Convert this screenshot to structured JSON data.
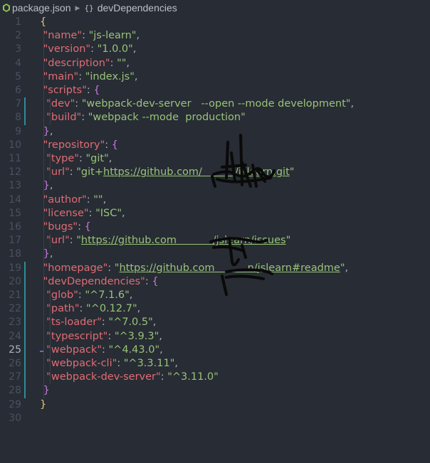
{
  "breadcrumb": {
    "file": "package.json",
    "section": "devDependencies"
  },
  "editor": {
    "active_line": 25,
    "line_numbers": [
      "1",
      "2",
      "3",
      "4",
      "5",
      "6",
      "7",
      "8",
      "9",
      "10",
      "11",
      "12",
      "13",
      "14",
      "15",
      "16",
      "17",
      "18",
      "19",
      "20",
      "21",
      "22",
      "23",
      "24",
      "25",
      "26",
      "27",
      "28",
      "29",
      "30"
    ],
    "lines": [
      [
        {
          "t": "{",
          "c": "b1"
        }
      ],
      [
        {
          "t": " "
        },
        {
          "t": "\"name\"",
          "c": "k"
        },
        {
          "t": ": "
        },
        {
          "t": "\"js-learn\"",
          "c": "s"
        },
        {
          "t": ","
        }
      ],
      [
        {
          "t": " "
        },
        {
          "t": "\"version\"",
          "c": "k"
        },
        {
          "t": ": "
        },
        {
          "t": "\"1.0.0\"",
          "c": "s"
        },
        {
          "t": ","
        }
      ],
      [
        {
          "t": " "
        },
        {
          "t": "\"description\"",
          "c": "k"
        },
        {
          "t": ": "
        },
        {
          "t": "\"\"",
          "c": "s"
        },
        {
          "t": ","
        }
      ],
      [
        {
          "t": " "
        },
        {
          "t": "\"main\"",
          "c": "k"
        },
        {
          "t": ": "
        },
        {
          "t": "\"index.js\"",
          "c": "s"
        },
        {
          "t": ","
        }
      ],
      [
        {
          "t": " "
        },
        {
          "t": "\"scripts\"",
          "c": "k"
        },
        {
          "t": ": "
        },
        {
          "t": "{",
          "c": "b2"
        }
      ],
      [
        {
          "t": "  "
        },
        {
          "t": "\"dev\"",
          "c": "k"
        },
        {
          "t": ": "
        },
        {
          "t": "\"webpack-dev-server   --open --mode development\"",
          "c": "s"
        },
        {
          "t": ","
        }
      ],
      [
        {
          "t": "  "
        },
        {
          "t": "\"build\"",
          "c": "k"
        },
        {
          "t": ": "
        },
        {
          "t": "\"webpack --mode  production\"",
          "c": "s"
        }
      ],
      [
        {
          "t": " "
        },
        {
          "t": "}",
          "c": "b2"
        },
        {
          "t": ","
        }
      ],
      [
        {
          "t": " "
        },
        {
          "t": "\"repository\"",
          "c": "k"
        },
        {
          "t": ": "
        },
        {
          "t": "{",
          "c": "b2"
        }
      ],
      [
        {
          "t": "  "
        },
        {
          "t": "\"type\"",
          "c": "k"
        },
        {
          "t": ": "
        },
        {
          "t": "\"git\"",
          "c": "s"
        },
        {
          "t": ","
        }
      ],
      [
        {
          "t": "  "
        },
        {
          "t": "\"url\"",
          "c": "k"
        },
        {
          "t": ": "
        },
        {
          "t": "\"git+",
          "c": "s"
        },
        {
          "t": "https://github.com/",
          "c": "s u"
        },
        {
          "t": "          ",
          "c": "s u"
        },
        {
          "t": "/jslearn.git",
          "c": "s u"
        },
        {
          "t": "\"",
          "c": "s"
        }
      ],
      [
        {
          "t": " "
        },
        {
          "t": "}",
          "c": "b2"
        },
        {
          "t": ","
        }
      ],
      [
        {
          "t": " "
        },
        {
          "t": "\"author\"",
          "c": "k"
        },
        {
          "t": ": "
        },
        {
          "t": "\"\"",
          "c": "s"
        },
        {
          "t": ","
        }
      ],
      [
        {
          "t": " "
        },
        {
          "t": "\"license\"",
          "c": "k"
        },
        {
          "t": ": "
        },
        {
          "t": "\"ISC\"",
          "c": "s"
        },
        {
          "t": ","
        }
      ],
      [
        {
          "t": " "
        },
        {
          "t": "\"bugs\"",
          "c": "k"
        },
        {
          "t": ": "
        },
        {
          "t": "{",
          "c": "b2"
        }
      ],
      [
        {
          "t": "  "
        },
        {
          "t": "\"url\"",
          "c": "k"
        },
        {
          "t": ": "
        },
        {
          "t": "\"",
          "c": "s"
        },
        {
          "t": "https://github.com",
          "c": "s u"
        },
        {
          "t": "           ",
          "c": "s u"
        },
        {
          "t": "/jslearn/issues",
          "c": "s u"
        },
        {
          "t": "\"",
          "c": "s"
        }
      ],
      [
        {
          "t": " "
        },
        {
          "t": "}",
          "c": "b2"
        },
        {
          "t": ","
        }
      ],
      [
        {
          "t": " "
        },
        {
          "t": "\"homepage\"",
          "c": "k"
        },
        {
          "t": ": "
        },
        {
          "t": "\"",
          "c": "s"
        },
        {
          "t": "https://github.com",
          "c": "s u"
        },
        {
          "t": "          ",
          "c": "s u"
        },
        {
          "t": "n/jslearn#readme",
          "c": "s u"
        },
        {
          "t": "\"",
          "c": "s"
        },
        {
          "t": ","
        }
      ],
      [
        {
          "t": " "
        },
        {
          "t": "\"devDependencies\"",
          "c": "k"
        },
        {
          "t": ": "
        },
        {
          "t": "{",
          "c": "b2"
        }
      ],
      [
        {
          "t": "  "
        },
        {
          "t": "\"glob\"",
          "c": "k"
        },
        {
          "t": ": "
        },
        {
          "t": "\"^7.1.6\"",
          "c": "s"
        },
        {
          "t": ","
        }
      ],
      [
        {
          "t": "  "
        },
        {
          "t": "\"path\"",
          "c": "k"
        },
        {
          "t": ": "
        },
        {
          "t": "\"^0.12.7\"",
          "c": "s"
        },
        {
          "t": ","
        }
      ],
      [
        {
          "t": "  "
        },
        {
          "t": "\"ts-loader\"",
          "c": "k"
        },
        {
          "t": ": "
        },
        {
          "t": "\"^7.0.5\"",
          "c": "s"
        },
        {
          "t": ","
        }
      ],
      [
        {
          "t": "  "
        },
        {
          "t": "\"typescript\"",
          "c": "k"
        },
        {
          "t": ": "
        },
        {
          "t": "\"^3.9.3\"",
          "c": "s"
        },
        {
          "t": ","
        }
      ],
      [
        {
          "t": "  "
        },
        {
          "t": "\"webpack\"",
          "c": "k"
        },
        {
          "t": ": "
        },
        {
          "t": "\"^4.43.0\"",
          "c": "s"
        },
        {
          "t": ","
        }
      ],
      [
        {
          "t": "  "
        },
        {
          "t": "\"webpack-cli\"",
          "c": "k"
        },
        {
          "t": ": "
        },
        {
          "t": "\"^3.3.11\"",
          "c": "s"
        },
        {
          "t": ","
        }
      ],
      [
        {
          "t": "  "
        },
        {
          "t": "\"webpack-dev-server\"",
          "c": "k"
        },
        {
          "t": ": "
        },
        {
          "t": "\"^3.11.0\"",
          "c": "s"
        }
      ],
      [
        {
          "t": " "
        },
        {
          "t": "}",
          "c": "b2"
        }
      ],
      [
        {
          "t": "}",
          "c": "b1"
        }
      ],
      []
    ]
  },
  "colors": {
    "background": "#282c34",
    "key": "#e06c75",
    "string": "#98c379",
    "brace_outer": "#e5c07b",
    "brace_inner": "#c678dd",
    "line_number": "#495162",
    "gutter_change": "#2d8d9b"
  },
  "icons": {
    "file": "json-file-icon",
    "breadcrumb_separator": "chevron-right-icon",
    "object": "braces-icon"
  }
}
